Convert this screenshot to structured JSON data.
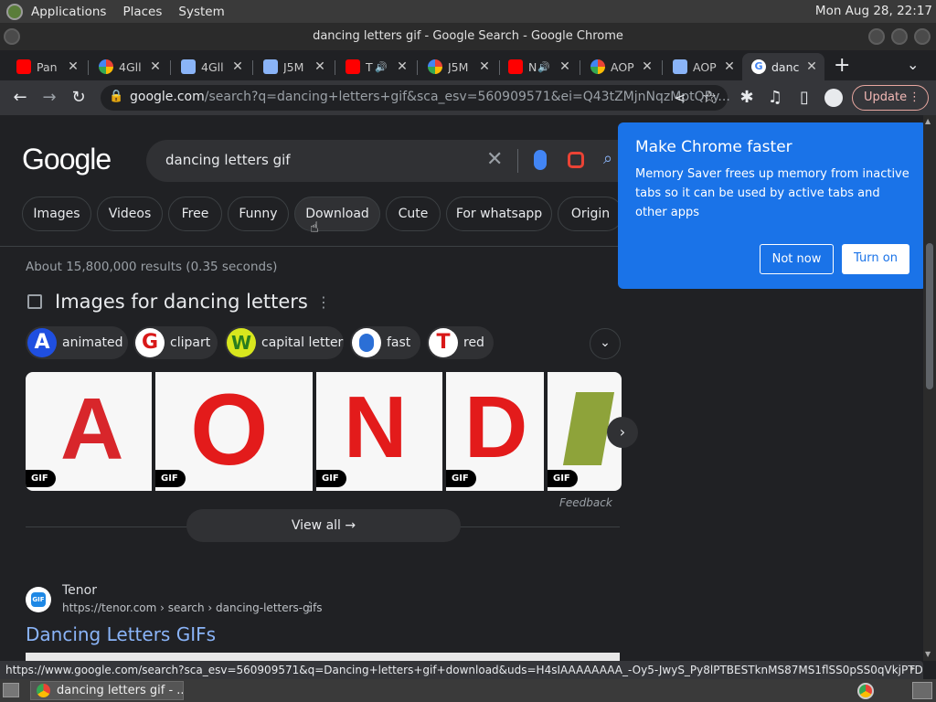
{
  "panel": {
    "menus": [
      "Applications",
      "Places",
      "System"
    ],
    "clock": "Mon Aug 28, 22:17"
  },
  "window": {
    "title": "dancing letters gif - Google Search - Google Chrome"
  },
  "tabs": [
    {
      "title": "Pan",
      "icon": "youtube-icon",
      "color": "#ff0000"
    },
    {
      "title": "4Gll",
      "icon": "pinwheel-icon",
      "color": "#34a853"
    },
    {
      "title": "4Gll",
      "icon": "image-icon",
      "color": "#8ab4f8"
    },
    {
      "title": "J5M",
      "icon": "image-icon",
      "color": "#8ab4f8"
    },
    {
      "title": "T",
      "icon": "youtube-icon",
      "color": "#ff0000"
    },
    {
      "title": "J5M",
      "icon": "pinwheel-icon",
      "color": "#34a853"
    },
    {
      "title": "N",
      "icon": "youtube-icon",
      "color": "#ff0000"
    },
    {
      "title": "AOP",
      "icon": "pinwheel-icon",
      "color": "#34a853"
    },
    {
      "title": "AOP",
      "icon": "image-icon",
      "color": "#8ab4f8"
    },
    {
      "title": "danc",
      "icon": "google-icon",
      "color": "#ffffff",
      "active": true
    }
  ],
  "toolbar": {
    "url_host": "google.com",
    "url_path": "/search?q=dancing+letters+gif&sca_esv=560909571&ei=Q43tZMjnNqzMptQPy...",
    "update_label": "Update"
  },
  "search": {
    "logo": "Google",
    "query": "dancing letters gif",
    "chips": [
      "Images",
      "Videos",
      "Free",
      "Funny",
      "Download",
      "Cute",
      "For whatsapp",
      "Origin"
    ],
    "result_stats": "About 15,800,000 results (0.35 seconds)"
  },
  "images": {
    "title": "Images for dancing letters",
    "suggestions": [
      "animated",
      "clipart",
      "capital letter",
      "fast",
      "red"
    ],
    "thumbs": [
      {
        "letter": "A",
        "badge": "GIF",
        "color": "#d8262b"
      },
      {
        "letter": "O",
        "badge": "GIF",
        "color": "#e31b1b"
      },
      {
        "letter": "N",
        "badge": "GIF",
        "color": "#e31b1b"
      },
      {
        "letter": "D",
        "badge": "GIF",
        "color": "#e31b1b"
      },
      {
        "letter": "",
        "badge": "GIF",
        "color": "#8ea33a"
      }
    ],
    "feedback": "Feedback",
    "view_all": "View all"
  },
  "result": {
    "site_name": "Tenor",
    "site_url": "https://tenor.com › search › dancing-letters-gifs",
    "title": "Dancing Letters GIFs",
    "favicon_text": "GIF"
  },
  "promo": {
    "heading": "Make Chrome faster",
    "body": "Memory Saver frees up memory from inactive tabs so it can be used by active tabs and other apps",
    "not_now": "Not now",
    "turn_on": "Turn on"
  },
  "status_url": "https://www.google.com/search?sca_esv=560909571&q=Dancing+letters+gif+download&uds=H4sIAAAAAAAA_-Oy5-JwyS_Py8lPTBESTknMS87MS1flSS0pSS0qVkjPTDM...",
  "taskbar": {
    "item": "dancing letters gif - ..."
  }
}
